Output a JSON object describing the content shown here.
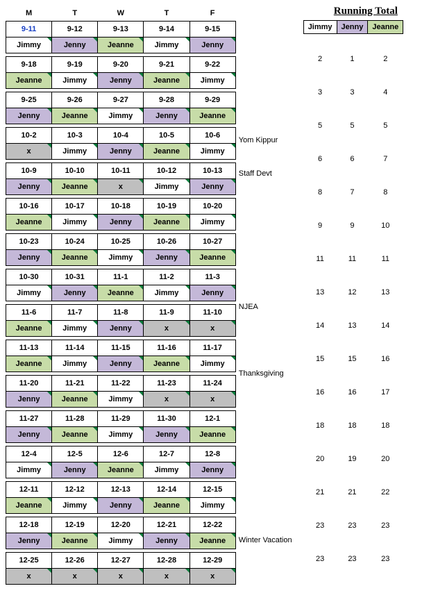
{
  "dayHeaders": [
    "M",
    "T",
    "W",
    "T",
    "F"
  ],
  "runningTotalTitle": "Running Total",
  "totalHeaders": [
    "Jimmy",
    "Jenny",
    "Jeanne"
  ],
  "weeks": [
    {
      "dates": [
        "9-11",
        "9-12",
        "9-13",
        "9-14",
        "9-15"
      ],
      "names": [
        "Jimmy",
        "Jenny",
        "Jeanne",
        "Jimmy",
        "Jenny"
      ],
      "note": "",
      "totals": [
        "2",
        "1",
        "2"
      ]
    },
    {
      "dates": [
        "9-18",
        "9-19",
        "9-20",
        "9-21",
        "9-22"
      ],
      "names": [
        "Jeanne",
        "Jimmy",
        "Jenny",
        "Jeanne",
        "Jimmy"
      ],
      "note": "",
      "totals": [
        "3",
        "3",
        "4"
      ]
    },
    {
      "dates": [
        "9-25",
        "9-26",
        "9-27",
        "9-28",
        "9-29"
      ],
      "names": [
        "Jenny",
        "Jeanne",
        "Jimmy",
        "Jenny",
        "Jeanne"
      ],
      "note": "",
      "totals": [
        "5",
        "5",
        "5"
      ]
    },
    {
      "dates": [
        "10-2",
        "10-3",
        "10-4",
        "10-5",
        "10-6"
      ],
      "names": [
        "x",
        "Jimmy",
        "Jenny",
        "Jeanne",
        "Jimmy"
      ],
      "note": "Yom Kippur",
      "totals": [
        "6",
        "6",
        "7"
      ]
    },
    {
      "dates": [
        "10-9",
        "10-10",
        "10-11",
        "10-12",
        "10-13"
      ],
      "names": [
        "Jenny",
        "Jeanne",
        "x",
        "Jimmy",
        "Jenny"
      ],
      "note": "Staff Devt",
      "totals": [
        "8",
        "7",
        "8"
      ]
    },
    {
      "dates": [
        "10-16",
        "10-17",
        "10-18",
        "10-19",
        "10-20"
      ],
      "names": [
        "Jeanne",
        "Jimmy",
        "Jenny",
        "Jeanne",
        "Jimmy"
      ],
      "note": "",
      "totals": [
        "9",
        "9",
        "10"
      ]
    },
    {
      "dates": [
        "10-23",
        "10-24",
        "10-25",
        "10-26",
        "10-27"
      ],
      "names": [
        "Jenny",
        "Jeanne",
        "Jimmy",
        "Jenny",
        "Jeanne"
      ],
      "note": "",
      "totals": [
        "11",
        "11",
        "11"
      ]
    },
    {
      "dates": [
        "10-30",
        "10-31",
        "11-1",
        "11-2",
        "11-3"
      ],
      "names": [
        "Jimmy",
        "Jenny",
        "Jeanne",
        "Jimmy",
        "Jenny"
      ],
      "note": "",
      "totals": [
        "13",
        "12",
        "13"
      ]
    },
    {
      "dates": [
        "11-6",
        "11-7",
        "11-8",
        "11-9",
        "11-10"
      ],
      "names": [
        "Jeanne",
        "Jimmy",
        "Jenny",
        "x",
        "x"
      ],
      "note": "NJEA",
      "totals": [
        "14",
        "13",
        "14"
      ]
    },
    {
      "dates": [
        "11-13",
        "11-14",
        "11-15",
        "11-16",
        "11-17"
      ],
      "names": [
        "Jeanne",
        "Jimmy",
        "Jenny",
        "Jeanne",
        "Jimmy"
      ],
      "note": "",
      "totals": [
        "15",
        "15",
        "16"
      ]
    },
    {
      "dates": [
        "11-20",
        "11-21",
        "11-22",
        "11-23",
        "11-24"
      ],
      "names": [
        "Jenny",
        "Jeanne",
        "Jimmy",
        "x",
        "x"
      ],
      "note": "Thanksgiving",
      "totals": [
        "16",
        "16",
        "17"
      ]
    },
    {
      "dates": [
        "11-27",
        "11-28",
        "11-29",
        "11-30",
        "12-1"
      ],
      "names": [
        "Jenny",
        "Jeanne",
        "Jimmy",
        "Jenny",
        "Jeanne"
      ],
      "note": "",
      "totals": [
        "18",
        "18",
        "18"
      ]
    },
    {
      "dates": [
        "12-4",
        "12-5",
        "12-6",
        "12-7",
        "12-8"
      ],
      "names": [
        "Jimmy",
        "Jenny",
        "Jeanne",
        "Jimmy",
        "Jenny"
      ],
      "note": "",
      "totals": [
        "20",
        "19",
        "20"
      ]
    },
    {
      "dates": [
        "12-11",
        "12-12",
        "12-13",
        "12-14",
        "12-15"
      ],
      "names": [
        "Jeanne",
        "Jimmy",
        "Jenny",
        "Jeanne",
        "Jimmy"
      ],
      "note": "",
      "totals": [
        "21",
        "21",
        "22"
      ]
    },
    {
      "dates": [
        "12-18",
        "12-19",
        "12-20",
        "12-21",
        "12-22"
      ],
      "names": [
        "Jenny",
        "Jeanne",
        "Jimmy",
        "Jenny",
        "Jeanne"
      ],
      "note": "",
      "totals": [
        "23",
        "23",
        "23"
      ]
    },
    {
      "dates": [
        "12-25",
        "12-26",
        "12-27",
        "12-28",
        "12-29"
      ],
      "names": [
        "x",
        "x",
        "x",
        "x",
        "x"
      ],
      "note": "Winter Vacation",
      "totals": [
        "23",
        "23",
        "23"
      ]
    }
  ],
  "colors": {
    "Jimmy": "#ffffff",
    "Jenny": "#c4b8d8",
    "Jeanne": "#c7dca8",
    "x": "#bfbfbf"
  },
  "highlightDate": "9-11"
}
